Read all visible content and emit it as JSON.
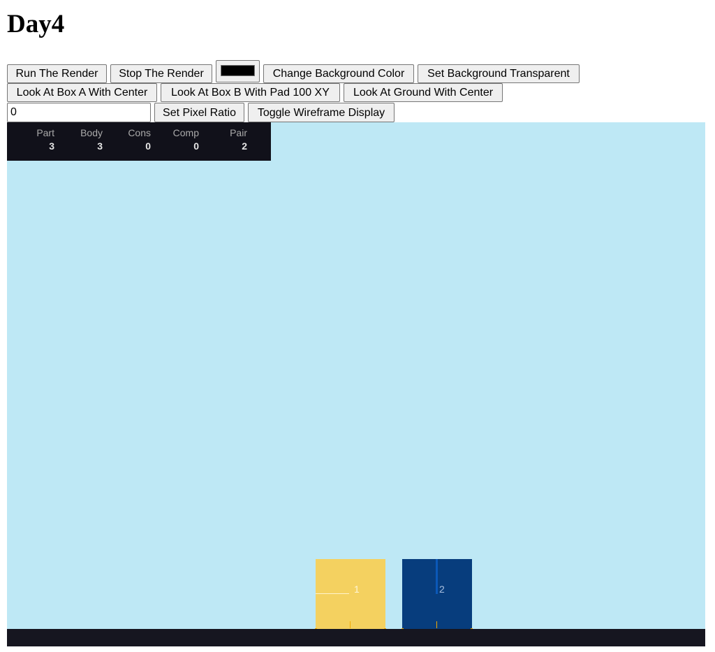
{
  "page": {
    "title": "Day4"
  },
  "toolbar": {
    "run_label": "Run The Render",
    "stop_label": "Stop The Render",
    "color_value": "#000000",
    "change_bg_label": "Change Background Color",
    "set_transparent_label": "Set Background Transparent",
    "look_box_a_label": "Look At Box A With Center",
    "look_box_b_label": "Look At Box B With Pad 100 XY",
    "look_ground_label": "Look At Ground With Center",
    "pixel_ratio_value": "0",
    "set_pixel_ratio_label": "Set Pixel Ratio",
    "toggle_wireframe_label": "Toggle Wireframe Display"
  },
  "stats": [
    {
      "label": "Part",
      "value": "3"
    },
    {
      "label": "Body",
      "value": "3"
    },
    {
      "label": "Cons",
      "value": "0"
    },
    {
      "label": "Comp",
      "value": "0"
    },
    {
      "label": "Pair",
      "value": "2"
    }
  ],
  "scene": {
    "background_color": "#bee8f5",
    "ground_color": "#161620",
    "box_a": {
      "label": "1",
      "color": "#f4d160"
    },
    "box_b": {
      "label": "2",
      "color": "#073d7d"
    }
  }
}
